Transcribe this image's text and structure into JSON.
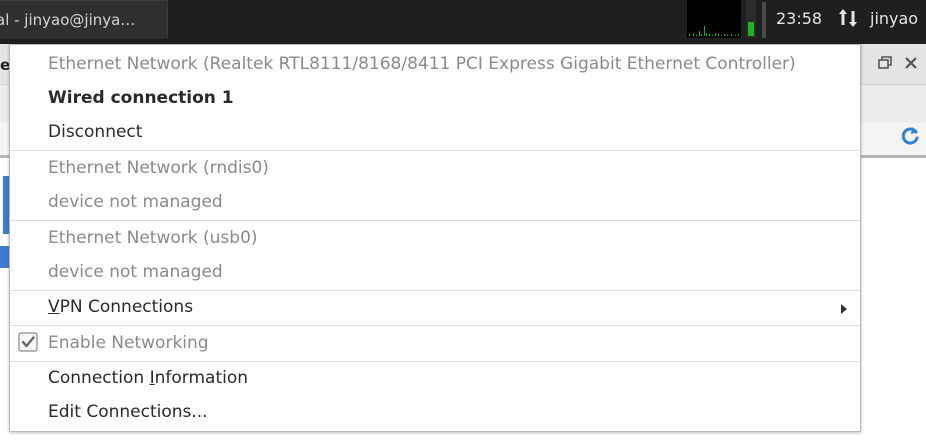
{
  "panel": {
    "task_title": "al - jinyao@jinya…",
    "clock": "23:58",
    "user": "jinyao"
  },
  "background": {
    "partial_letter": "e"
  },
  "menu": {
    "ethernet_realtek_header": "Ethernet Network (Realtek RTL8111/8168/8411 PCI Express Gigabit Ethernet Controller)",
    "wired_connection": "Wired connection 1",
    "disconnect": "Disconnect",
    "ethernet_rndis_header": "Ethernet Network (rndis0)",
    "rndis_status": "device not managed",
    "ethernet_usb_header": "Ethernet Network (usb0)",
    "usb_status": "device not managed",
    "vpn_first": "V",
    "vpn_rest": "PN Connections",
    "enable_networking": "Enable Networking",
    "conn_info_a": "Connection ",
    "conn_info_b": "I",
    "conn_info_c": "nformation",
    "edit_connections": "Edit Connections..."
  },
  "colors": {
    "panel_bg": "#1f1f1f",
    "graph_green": "#1db41d",
    "selection_blue": "#3e7bd0"
  },
  "icons": [
    "network-updown-icon",
    "checkbox-checked-icon",
    "submenu-arrow-icon",
    "reload-icon",
    "restore-window-icon",
    "close-icon"
  ]
}
